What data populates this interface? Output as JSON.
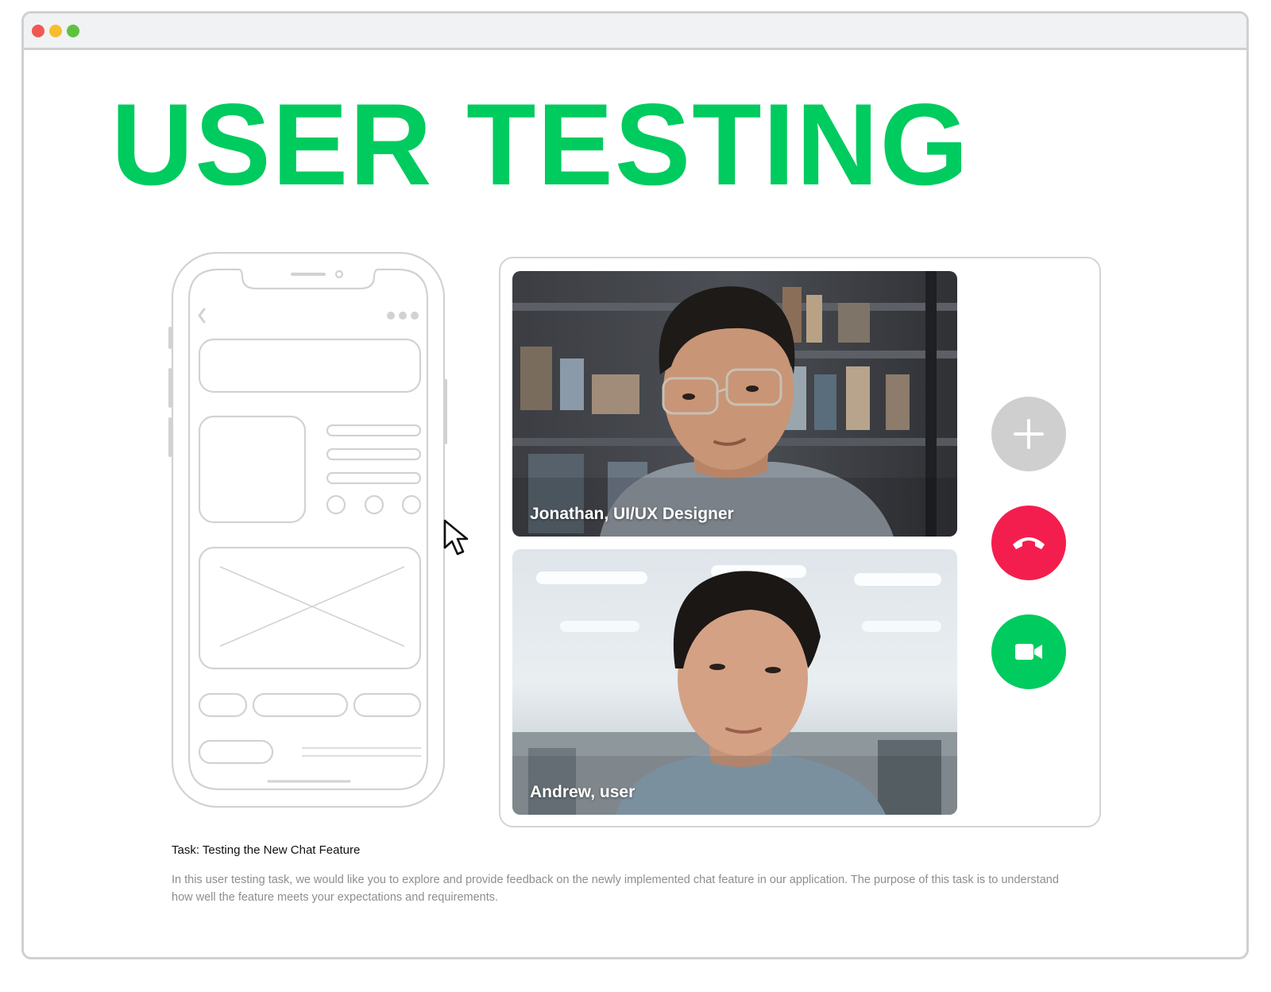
{
  "window": {
    "buttons": [
      {
        "name": "close",
        "color": "#ee5a52"
      },
      {
        "name": "minimize",
        "color": "#f5be2f"
      },
      {
        "name": "maximize",
        "color": "#5fc23f"
      }
    ]
  },
  "header": {
    "title": "USER TESTING",
    "title_color": "#00cb5e"
  },
  "phone_wireframe": {
    "icons": [
      "back-chevron-icon",
      "more-dots-icon",
      "image-placeholder-icon"
    ]
  },
  "video_call": {
    "participants": [
      {
        "label": "Jonathan, UI/UX Designer"
      },
      {
        "label": "Andrew, user"
      }
    ],
    "controls": [
      {
        "icon": "plus-icon",
        "color": "#cfcfcf"
      },
      {
        "icon": "phone-hangup-icon",
        "color": "#f41e4e"
      },
      {
        "icon": "video-camera-icon",
        "color": "#00cb5e"
      }
    ]
  },
  "task": {
    "title": "Task: Testing the New Chat Feature",
    "description": "In this user testing task, we would like you to explore and provide feedback on the newly implemented chat feature in our application. The purpose of this task is to understand how well the feature meets your expectations and requirements."
  }
}
